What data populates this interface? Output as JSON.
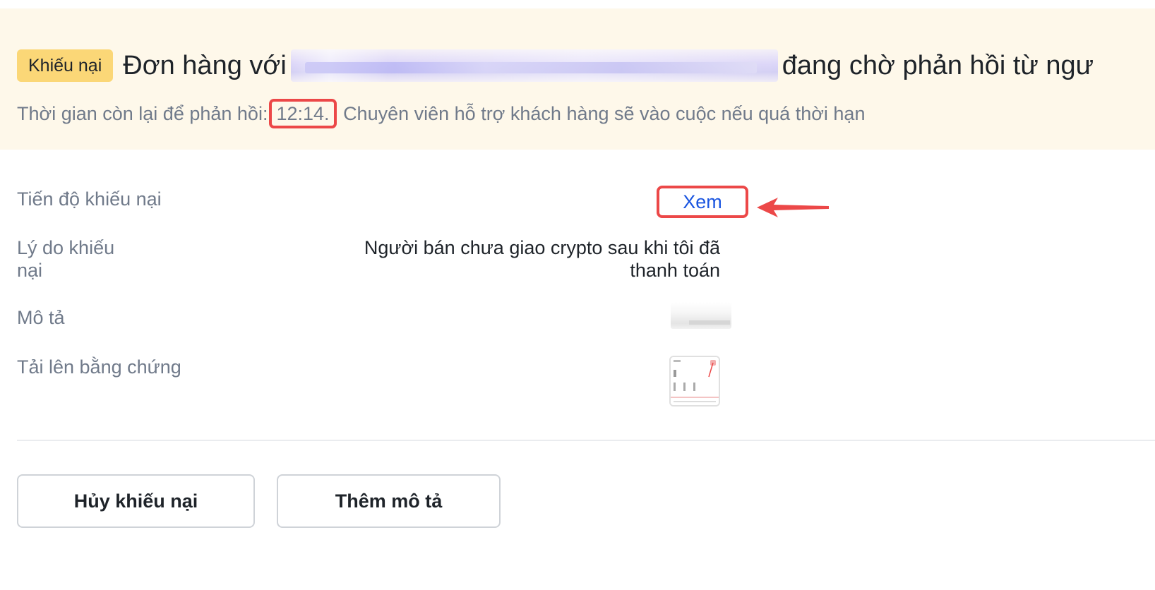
{
  "banner": {
    "badge": "Khiếu nại",
    "title_prefix": "Đơn hàng với",
    "title_suffix": "đang chờ phản hồi từ ngư",
    "subtitle_prefix": "Thời gian còn lại để phản hồi",
    "subtitle_colon": ":",
    "timer": "12:14.",
    "subtitle_suffix": "Chuyên viên hỗ trợ khách hàng sẽ vào cuộc nếu quá thời hạn",
    "background_color": "#fef8ea",
    "badge_color": "#fbd777"
  },
  "details": {
    "progress_label": "Tiến độ khiếu nại",
    "progress_link": "Xem",
    "reason_label_line1": "Lý do khiếu",
    "reason_label_line2": "nại",
    "reason_value_line1": "Người bán chưa giao crypto sau khi tôi đã",
    "reason_value_line2": "thanh toán",
    "description_label": "Mô tả",
    "evidence_label": "Tải lên bằng chứng"
  },
  "actions": {
    "cancel_label": "Hủy khiếu nại",
    "add_description_label": "Thêm mô tả"
  },
  "icons": {
    "annotation_arrow": "red-arrow-icon",
    "evidence_thumbnail": "image-thumbnail-icon"
  },
  "colors": {
    "link": "#1a55e0",
    "highlight": "#ec4848",
    "label_text": "#707a8a",
    "main_text": "#1e2329"
  }
}
